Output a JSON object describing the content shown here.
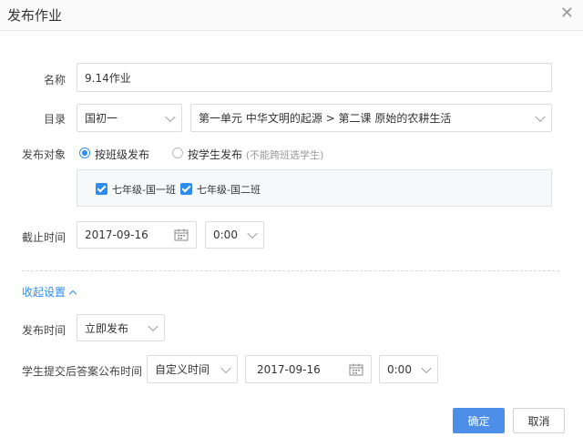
{
  "dialog": {
    "title": "发布作业",
    "close_icon": "close-icon"
  },
  "form": {
    "name_label": "名称",
    "name_value": "9.14作业",
    "catalog_label": "目录",
    "catalog_grade": "国初一",
    "catalog_lesson": "第一单元 中华文明的起源 > 第二课 原始的农耕生活",
    "target_label": "发布对象",
    "target_options": [
      {
        "label": "按班级发布",
        "hint": "",
        "selected": true
      },
      {
        "label": "按学生发布",
        "hint": "(不能跨班选学生)",
        "selected": false
      }
    ],
    "classes": [
      {
        "label": "七年级-国一班",
        "checked": true
      },
      {
        "label": "七年级-国二班",
        "checked": true
      }
    ],
    "deadline_label": "截止时间",
    "deadline_date": "2017-09-16",
    "deadline_time": "0:00"
  },
  "collapse": {
    "label": "收起设置"
  },
  "settings": {
    "publish_time_label": "发布时间",
    "publish_time_value": "立即发布",
    "answer_time_label": "学生提交后答案公布时间",
    "answer_mode_value": "自定义时间",
    "answer_date": "2017-09-16",
    "answer_time": "0:00"
  },
  "footer": {
    "ok_label": "确定",
    "cancel_label": "取消"
  },
  "colors": {
    "accent": "#2d8cf0",
    "primary_button": "#4d8ee8"
  }
}
